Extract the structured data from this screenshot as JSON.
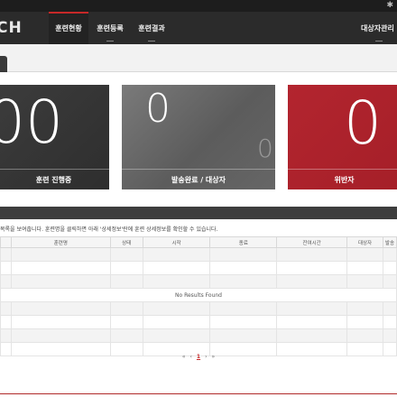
{
  "app": {
    "logo_text": "CH",
    "settings_glyph": "✱"
  },
  "nav": {
    "items": [
      {
        "label": "훈련현황",
        "active": true
      },
      {
        "label": "훈련등록",
        "active": false
      },
      {
        "label": "훈련결과",
        "active": false
      }
    ],
    "right_item": "대상자관리"
  },
  "cards": [
    {
      "value": "00",
      "label": "훈련 진행중",
      "color": "#333333"
    },
    {
      "value": "0",
      "secondary": "0",
      "label": "발송완료 / 대상자",
      "color": "#6b6b6b"
    },
    {
      "value": "0",
      "label": "위반자",
      "color": "#ac222b"
    }
  ],
  "info_text": "목록을 보여줍니다. 훈련명을 클릭하면 아래 '상세정보'란에 훈련 상세정보를 확인할 수 있습니다.",
  "table": {
    "columns": [
      "",
      "훈련명",
      "상태",
      "시작",
      "종료",
      "잔여시간",
      "대상자",
      "발송"
    ],
    "empty_message": "No Results Found"
  },
  "pager": {
    "first": "«",
    "prev": "‹",
    "current": "1",
    "next": "›",
    "last": "»"
  },
  "colors": {
    "accent": "#c62828"
  }
}
